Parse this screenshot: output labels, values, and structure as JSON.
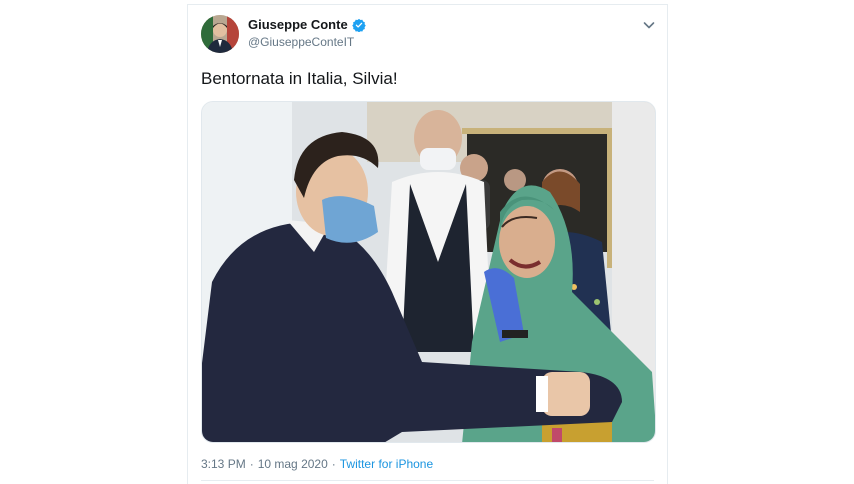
{
  "tweet": {
    "author": {
      "display_name": "Giuseppe Conte",
      "handle": "@GiuseppeConteIT",
      "verified_icon": "verified-badge-icon",
      "avatar_alt": "profile-avatar"
    },
    "text": "Bentornata in Italia, Silvia!",
    "photo_label": "tweet-photo",
    "time": "3:13 PM",
    "separator": "·",
    "date": "10 mag 2020",
    "source": "Twitter for iPhone",
    "menu_icon": "chevron-down-icon"
  },
  "colors": {
    "text": "#14171a",
    "secondary": "#657786",
    "link": "#1b95e0",
    "verified": "#1da1f2",
    "border": "#e6ecf0"
  }
}
